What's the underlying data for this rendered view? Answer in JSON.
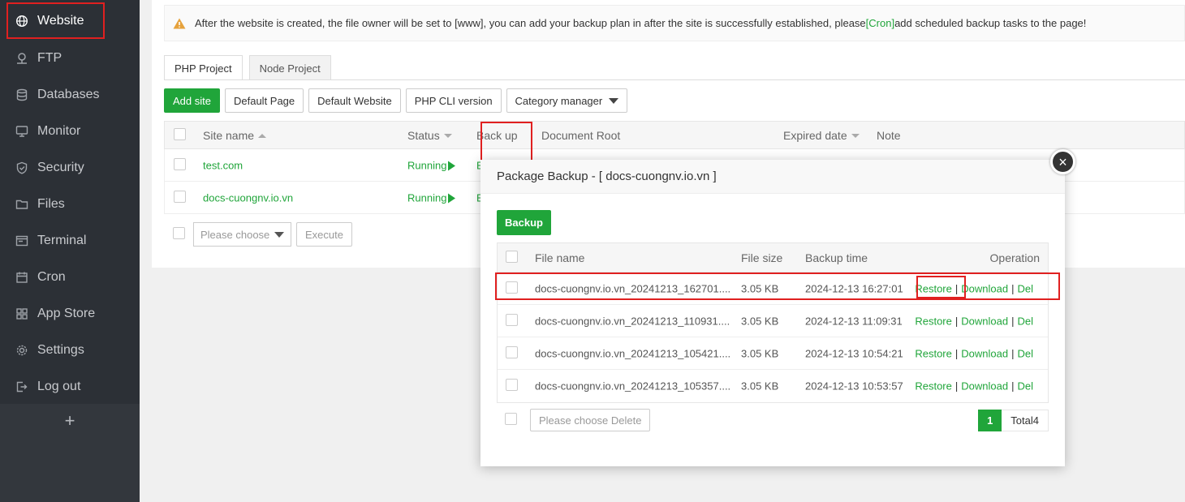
{
  "sidebar": {
    "items": [
      {
        "label": "Website",
        "icon": "globe-icon"
      },
      {
        "label": "FTP",
        "icon": "ftp-icon"
      },
      {
        "label": "Databases",
        "icon": "database-icon"
      },
      {
        "label": "Monitor",
        "icon": "monitor-icon"
      },
      {
        "label": "Security",
        "icon": "shield-icon"
      },
      {
        "label": "Files",
        "icon": "folder-icon"
      },
      {
        "label": "Terminal",
        "icon": "terminal-icon"
      },
      {
        "label": "Cron",
        "icon": "calendar-icon"
      },
      {
        "label": "App Store",
        "icon": "grid-icon"
      },
      {
        "label": "Settings",
        "icon": "gear-icon"
      },
      {
        "label": "Log out",
        "icon": "logout-icon"
      }
    ],
    "add": "+"
  },
  "notice": {
    "text_before": "After the website is created, the file owner will be set to [www], you can add your backup plan in after the site is successfully established, please",
    "link": "[Cron]",
    "text_after": "add scheduled backup tasks to the page!"
  },
  "tabs": [
    "PHP Project",
    "Node Project"
  ],
  "toolbar": {
    "add_site": "Add site",
    "default_page": "Default Page",
    "default_website": "Default Website",
    "php_cli": "PHP CLI version",
    "category_manager": "Category manager"
  },
  "sites_table": {
    "headers": {
      "site_name": "Site name",
      "status": "Status",
      "backup": "Back up",
      "document_root": "Document Root",
      "expired_date": "Expired date",
      "note": "Note"
    },
    "rows": [
      {
        "name": "test.com",
        "status": "Running",
        "backup": "E"
      },
      {
        "name": "docs-cuongnv.io.vn",
        "status": "Running",
        "backup": "E"
      }
    ]
  },
  "batch": {
    "select_placeholder": "Please choose",
    "execute": "Execute"
  },
  "modal": {
    "title": "Package Backup - [ docs-cuongnv.io.vn ]",
    "backup_button": "Backup",
    "close": "×",
    "headers": {
      "file_name": "File name",
      "file_size": "File size",
      "backup_time": "Backup time",
      "operation": "Operation"
    },
    "rows": [
      {
        "file": "docs-cuongnv.io.vn_20241213_162701....",
        "size": "3.05 KB",
        "time": "2024-12-13 16:27:01"
      },
      {
        "file": "docs-cuongnv.io.vn_20241213_110931....",
        "size": "3.05 KB",
        "time": "2024-12-13 11:09:31"
      },
      {
        "file": "docs-cuongnv.io.vn_20241213_105421....",
        "size": "3.05 KB",
        "time": "2024-12-13 10:54:21"
      },
      {
        "file": "docs-cuongnv.io.vn_20241213_105357....",
        "size": "3.05 KB",
        "time": "2024-12-13 10:53:57"
      }
    ],
    "ops": {
      "restore": "Restore",
      "download": "Download",
      "del": "Del",
      "sep": "|"
    },
    "footer": {
      "delete_placeholder": "Please choose Delete",
      "page": "1",
      "total": "Total4"
    }
  },
  "colors": {
    "accent": "#20a53a",
    "highlight": "#e02020",
    "sidebar": "#2c3036"
  }
}
